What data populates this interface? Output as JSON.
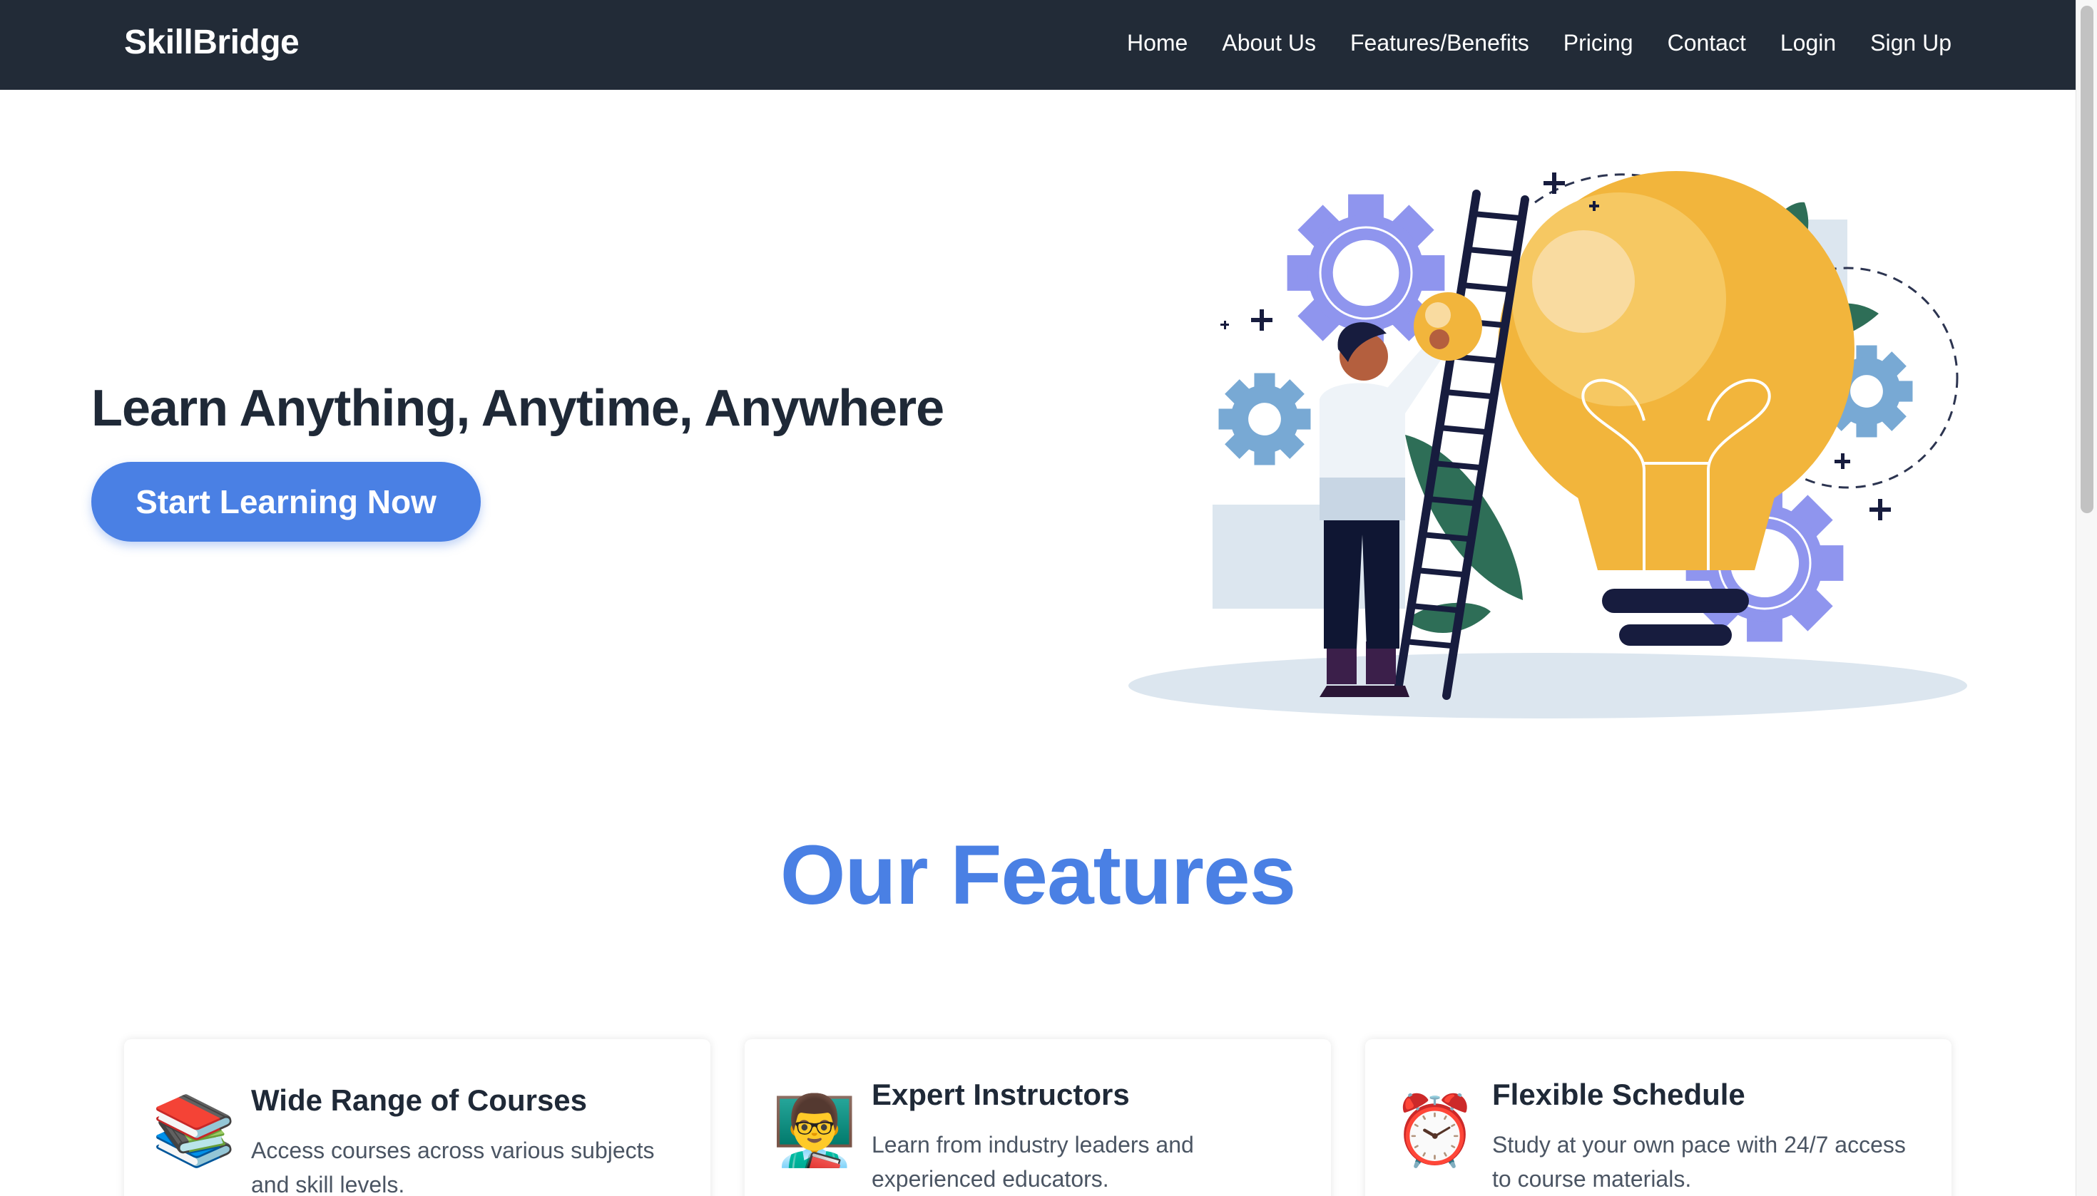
{
  "navbar": {
    "brand": "SkillBridge",
    "links": [
      {
        "label": "Home"
      },
      {
        "label": "About Us"
      },
      {
        "label": "Features/Benefits"
      },
      {
        "label": "Pricing"
      },
      {
        "label": "Contact"
      },
      {
        "label": "Login"
      },
      {
        "label": "Sign Up"
      }
    ]
  },
  "hero": {
    "title": "Learn Anything, Anytime, Anywhere",
    "cta_label": "Start Learning Now"
  },
  "features": {
    "title": "Our Features",
    "cards": [
      {
        "icon": "books-icon",
        "emoji": "📚",
        "title": "Wide Range of Courses",
        "description": "Access courses across various subjects and skill levels."
      },
      {
        "icon": "teacher-icon",
        "emoji": "👨‍🏫",
        "title": "Expert Instructors",
        "description": "Learn from industry leaders and experienced educators."
      },
      {
        "icon": "alarm-clock-icon",
        "emoji": "⏰",
        "title": "Flexible Schedule",
        "description": "Study at your own pace with 24/7 access to course materials."
      }
    ]
  },
  "colors": {
    "navbar_bg": "#222b37",
    "accent": "#4a80e4",
    "text_dark": "#1f2937",
    "text_muted": "#4b5563",
    "bulb": "#f2b53c",
    "gear": "#8f95ee",
    "gear_small": "#78a9d4",
    "leaf": "#2e6e57",
    "ladder": "#171c3e"
  }
}
